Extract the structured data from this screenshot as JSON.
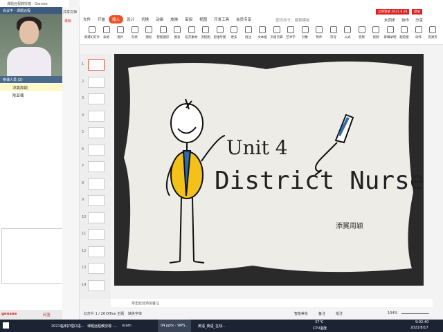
{
  "gensee": {
    "title": "课题远程教授端 - Gensee",
    "tab": "会议中 - 课题远程",
    "participants_header": "参课人员 (2)",
    "participants": [
      "添翼周颖",
      "陈亚楠"
    ],
    "logo": "gensee",
    "qa": "问答",
    "chat": "聊天"
  },
  "side": {
    "share": "共享文档",
    "record": "录制"
  },
  "wps": {
    "vip": "立即登录 2021.8.28",
    "login": "登录",
    "tabs": [
      "文件",
      "开始",
      "插入",
      "设计",
      "切换",
      "动画",
      "放映",
      "审阅",
      "视图",
      "开发工具",
      "会员专享"
    ],
    "active_tab": "插入",
    "search": "查找命令、搜索模板",
    "actions": [
      "未同步",
      "协作",
      "分享"
    ],
    "tools": [
      "新建幻灯片",
      "表格",
      "图片",
      "形状",
      "图标",
      "智能图形",
      "图表",
      "稻壳素材",
      "流程图",
      "思维导图",
      "更多",
      "批注",
      "文本框",
      "页眉页脚",
      "艺术字",
      "对象",
      "附件",
      "符号",
      "公式",
      "音频",
      "视频",
      "屏幕录制",
      "超链接",
      "动作",
      "资源夹"
    ],
    "tools_small": [
      "幻灯片编号",
      "日期和时间"
    ],
    "thumb_numbers": [
      "1",
      "2",
      "3",
      "4",
      "5",
      "6",
      "7",
      "8",
      "9",
      "10",
      "11",
      "12",
      "13",
      "14"
    ],
    "slide": {
      "title": "Unit 4",
      "subtitle": "District Nurse",
      "author": "添翼周颖"
    },
    "notes": "单击此处添加备注",
    "status": {
      "slide": "幻灯片 1 / 26",
      "theme": "Office 主题",
      "font": "缺失字体",
      "beautify": "智能美化",
      "notes": "备注",
      "comments": "批注",
      "zoom": "104%",
      "zoom_level": 104
    }
  },
  "taskbar": {
    "items": [
      "2021临床护理口语...",
      "课题远程教授端 -...",
      "ocam",
      "04.pptx - WPS...",
      "英语_英语_在线..."
    ],
    "temp": "37°C",
    "cpu": "CPU温度",
    "time": "9:02:40",
    "date": "2021/8/17"
  },
  "colors": {
    "accent": "#e8542a",
    "slide_bg": "#2a2a2a",
    "card": "#eeece6"
  }
}
